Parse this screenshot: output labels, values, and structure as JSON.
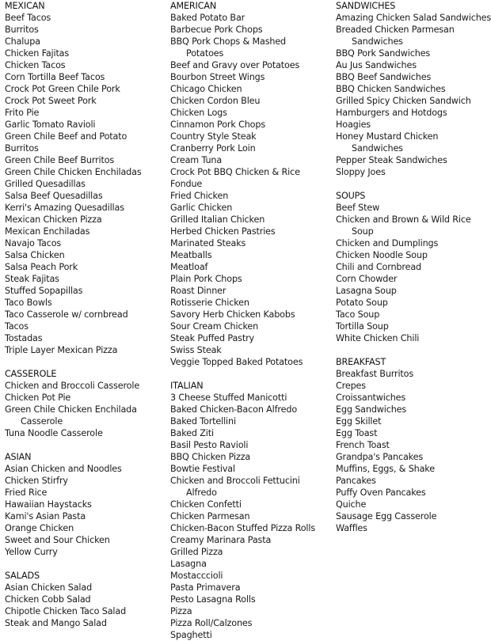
{
  "columns": [
    [
      {
        "title": "MEXICAN",
        "items": [
          [
            "Beef Tacos"
          ],
          [
            "Burritos"
          ],
          [
            "Chalupa"
          ],
          [
            "Chicken Fajitas"
          ],
          [
            "Chicken Tacos"
          ],
          [
            "Corn Tortilla Beef Tacos"
          ],
          [
            "Crock Pot Green Chile Pork"
          ],
          [
            "Crock Pot Sweet Pork"
          ],
          [
            "Frito Pie"
          ],
          [
            "Garlic Tomato Ravioli"
          ],
          [
            "Green Chile Beef and Potato"
          ],
          [
            "Burritos"
          ],
          [
            "Green Chile Beef Burritos"
          ],
          [
            "Green Chile Chicken Enchiladas"
          ],
          [
            "Grilled Quesadillas"
          ],
          [
            "Salsa Beef Quesadillas"
          ],
          [
            "Kerri's Amazing Quesadillas"
          ],
          [
            "Mexican Chicken Pizza"
          ],
          [
            "Mexican Enchiladas"
          ],
          [
            "Navajo Tacos"
          ],
          [
            "Salsa Chicken"
          ],
          [
            "Salsa Peach Pork"
          ],
          [
            "Steak Fajitas"
          ],
          [
            "Stuffed Sopapillas"
          ],
          [
            "Taco Bowls"
          ],
          [
            "Taco Casserole w/ cornbread"
          ],
          [
            "Tacos"
          ],
          [
            "Tostadas"
          ],
          [
            "Triple Layer Mexican Pizza"
          ]
        ]
      },
      {
        "title": "CASSEROLE",
        "items": [
          [
            "Chicken and Broccoli Casserole"
          ],
          [
            "Chicken Pot Pie"
          ],
          [
            "Green Chile Chicken Enchilada",
            "Casserole"
          ],
          [
            "Tuna Noodle Casserole"
          ]
        ]
      },
      {
        "title": "ASIAN",
        "items": [
          [
            "Asian Chicken and Noodles"
          ],
          [
            "Chicken Stirfry"
          ],
          [
            "Fried Rice"
          ],
          [
            "Hawaiian Haystacks"
          ],
          [
            "Kami's Asian Pasta"
          ],
          [
            "Orange Chicken"
          ],
          [
            "Sweet and Sour Chicken"
          ],
          [
            "Yellow Curry"
          ]
        ]
      },
      {
        "title": "SALADS",
        "items": [
          [
            "Asian Chicken Salad"
          ],
          [
            "Chicken Cobb Salad"
          ],
          [
            "Chipotle Chicken Taco Salad"
          ],
          [
            "Steak and Mango Salad"
          ]
        ]
      }
    ],
    [
      {
        "title": "AMERICAN",
        "items": [
          [
            "Baked Potato Bar"
          ],
          [
            "Barbecue Pork Chops"
          ],
          [
            "BBQ Pork Chops & Mashed",
            "Potatoes"
          ],
          [
            "Beef and Gravy over Potatoes"
          ],
          [
            "Bourbon Street Wings"
          ],
          [
            "Chicago Chicken"
          ],
          [
            "Chicken Cordon Bleu"
          ],
          [
            "Chicken Logs"
          ],
          [
            "Cinnamon Pork Chops"
          ],
          [
            "Country Style Steak"
          ],
          [
            "Cranberry Pork Loin"
          ],
          [
            "Cream Tuna"
          ],
          [
            "Crock Pot BBQ Chicken & Rice"
          ],
          [
            "Fondue"
          ],
          [
            "Fried Chicken"
          ],
          [
            "Garlic Chicken"
          ],
          [
            "Grilled Italian Chicken"
          ],
          [
            "Herbed Chicken Pastries"
          ],
          [
            "Marinated Steaks"
          ],
          [
            "Meatballs"
          ],
          [
            "Meatloaf"
          ],
          [
            "Plain Pork Chops"
          ],
          [
            "Roast Dinner"
          ],
          [
            "Rotisserie Chicken"
          ],
          [
            "Savory Herb Chicken Kabobs"
          ],
          [
            "Sour Cream Chicken"
          ],
          [
            "Steak Puffed Pastry"
          ],
          [
            "Swiss Steak"
          ],
          [
            "Veggie Topped Baked Potatoes"
          ]
        ]
      },
      {
        "title": "ITALIAN",
        "items": [
          [
            "3 Cheese Stuffed Manicotti"
          ],
          [
            "Baked Chicken-Bacon Alfredo"
          ],
          [
            "Baked Tortellini"
          ],
          [
            "Baked Ziti"
          ],
          [
            "Basil Pesto Ravioli"
          ],
          [
            "BBQ Chicken Pizza"
          ],
          [
            "Bowtie Festival"
          ],
          [
            "Chicken and Broccoli Fettucini",
            "Alfredo"
          ],
          [
            "Chicken Confetti"
          ],
          [
            "Chicken Parmesan"
          ],
          [
            "Chicken-Bacon Stuffed Pizza Rolls"
          ],
          [
            "Creamy Marinara Pasta"
          ],
          [
            "Grilled Pizza"
          ],
          [
            "Lasagna"
          ],
          [
            "Mostacccioli"
          ],
          [
            "Pasta Primavera"
          ],
          [
            "Pesto Lasagna Rolls"
          ],
          [
            "Pizza"
          ],
          [
            "Pizza Roll/Calzones"
          ],
          [
            "Spaghetti"
          ]
        ]
      }
    ],
    [
      {
        "title": "SANDWICHES",
        "items": [
          [
            "Amazing Chicken Salad Sandwiches"
          ],
          [
            "Breaded Chicken Parmesan",
            "Sandwiches"
          ],
          [
            "BBQ Pork Sandwiches"
          ],
          [
            "Au Jus Sandwiches"
          ],
          [
            "BBQ Beef Sandwiches"
          ],
          [
            "BBQ Chicken Sandwiches"
          ],
          [
            "Grilled Spicy Chicken Sandwich"
          ],
          [
            "Hamburgers and Hotdogs"
          ],
          [
            "Hoagies"
          ],
          [
            "Honey Mustard Chicken",
            "Sandwiches"
          ],
          [
            "Pepper Steak Sandwiches"
          ],
          [
            "Sloppy Joes"
          ]
        ]
      },
      {
        "title": "SOUPS",
        "items": [
          [
            "Beef Stew"
          ],
          [
            "Chicken and Brown & Wild Rice",
            "Soup"
          ],
          [
            "Chicken and Dumplings"
          ],
          [
            "Chicken Noodle Soup"
          ],
          [
            "Chili and Cornbread"
          ],
          [
            "Corn Chowder"
          ],
          [
            "Lasagna Soup"
          ],
          [
            "Potato Soup"
          ],
          [
            "Taco Soup"
          ],
          [
            "Tortilla Soup"
          ],
          [
            "White Chicken Chili"
          ]
        ]
      },
      {
        "title": "BREAKFAST",
        "items": [
          [
            "Breakfast Burritos"
          ],
          [
            "Crepes"
          ],
          [
            "Croissantwiches"
          ],
          [
            "Egg Sandwiches"
          ],
          [
            "Egg Skillet"
          ],
          [
            "Egg Toast"
          ],
          [
            "French Toast"
          ],
          [
            "Grandpa's Pancakes"
          ],
          [
            "Muffins, Eggs, & Shake"
          ],
          [
            "Pancakes"
          ],
          [
            "Puffy Oven Pancakes"
          ],
          [
            "Quiche"
          ],
          [
            "Sausage Egg Casserole"
          ],
          [
            "Waffles"
          ]
        ]
      }
    ]
  ]
}
